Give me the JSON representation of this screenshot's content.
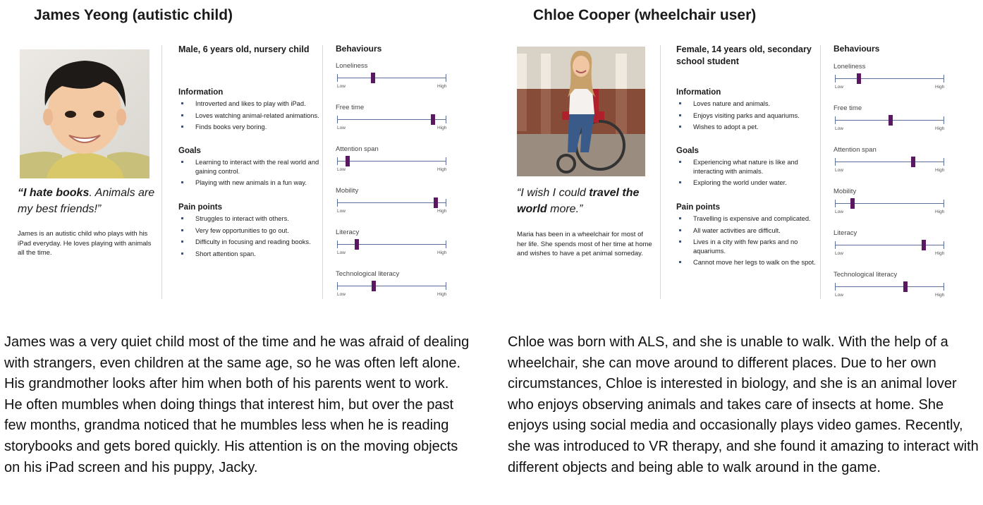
{
  "personas": [
    {
      "title": "James Yeong (autistic child)",
      "demographics": "Male, 6 years old, nursery child",
      "quote_bold": "“I hate books",
      "quote_rest": ". Animals are my best friends!”",
      "description": "James is an autistic child who plays with his iPad everyday. He loves playing with animals all the time.",
      "sections": {
        "information": {
          "heading": "Information",
          "items": [
            "Introverted and likes to play with iPad.",
            "Loves watching animal-related animations.",
            "Finds books very boring."
          ]
        },
        "goals": {
          "heading": "Goals",
          "items": [
            "Learning to interact with the real world and gaining control.",
            "Playing with new animals in a fun way."
          ]
        },
        "pain_points": {
          "heading": "Pain points",
          "items": [
            "Struggles to interact with others.",
            "Very few opportunities to go out.",
            "Difficulty in focusing and reading books.",
            "Short attention span."
          ]
        }
      },
      "behaviours_heading": "Behaviours",
      "behaviours": [
        {
          "label": "Loneliness",
          "level": 0.33
        },
        {
          "label": "Free time",
          "level": 0.88
        },
        {
          "label": "Attention span",
          "level": 0.1
        },
        {
          "label": "Mobility",
          "level": 0.91
        },
        {
          "label": "Literacy",
          "level": 0.18
        },
        {
          "label": "Technological literacy",
          "level": 0.34
        }
      ],
      "story": "James was a very quiet child most of the time and he was afraid of dealing with strangers, even children at the same age, so he was often left alone. His grandmother looks after him when both of his parents went to work. He often mumbles when doing things that interest him, but over the past few months, grandma noticed that he mumbles less when he is reading storybooks and gets bored quickly. His attention is on the moving objects on his iPad screen and his puppy, Jacky."
    },
    {
      "title": "Chloe Cooper (wheelchair user)",
      "demographics": "Female, 14 years old, secondary school student",
      "quote_pre": "“I wish I could ",
      "quote_bold": "travel the world",
      "quote_post": " more.”",
      "description": "Maria has been in a wheelchair for most of her life. She spends most of her time at home and wishes to have a pet animal someday.",
      "sections": {
        "information": {
          "heading": "Information",
          "items": [
            "Loves nature and animals.",
            "Enjoys visiting parks and aquariums.",
            "Wishes to adopt a pet."
          ]
        },
        "goals": {
          "heading": "Goals",
          "items": [
            "Experiencing what nature is like and interacting with animals.",
            "Exploring the world under water."
          ]
        },
        "pain_points": {
          "heading": "Pain points",
          "items": [
            "Travelling is expensive and complicated.",
            "All water activities are difficult.",
            "Lives in a city with few parks and no aquariums.",
            "Cannot move her legs to walk on the spot."
          ]
        }
      },
      "behaviours_heading": "Behaviours",
      "behaviours": [
        {
          "label": "Loneliness",
          "level": 0.22
        },
        {
          "label": "Free time",
          "level": 0.51
        },
        {
          "label": "Attention span",
          "level": 0.72
        },
        {
          "label": "Mobility",
          "level": 0.16
        },
        {
          "label": "Literacy",
          "level": 0.82
        },
        {
          "label": "Technological literacy",
          "level": 0.65
        }
      ],
      "story": "Chloe was born with ALS, and she is unable to walk. With the help of a wheelchair, she can move around to different places. Due to her own circumstances, Chloe is interested in biology, and she is an animal lover who enjoys observing animals and takes care of insects at home. She enjoys using social media and occasionally plays video games. Recently, she was introduced to VR therapy, and she found it amazing to interact with different objects and being able to walk around in the game."
    }
  ],
  "scale": {
    "low": "Low",
    "high": "High"
  },
  "colors": {
    "marker": "#5a1863",
    "track": "#5b6f9a",
    "bullet": "#2f5597"
  }
}
